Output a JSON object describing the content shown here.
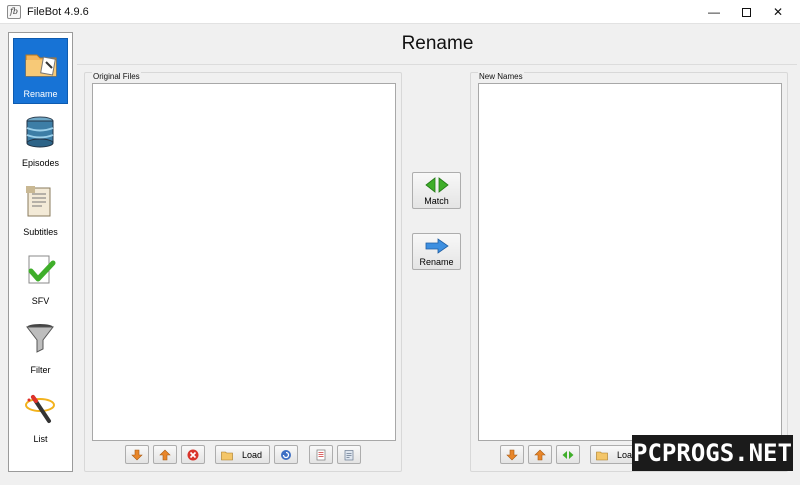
{
  "window": {
    "title": "FileBot 4.9.6",
    "app_icon_text": "fb",
    "min": "—",
    "close": "✕"
  },
  "sidebar": {
    "items": [
      {
        "label": "Rename",
        "icon": "folder-rename-icon",
        "active": true
      },
      {
        "label": "Episodes",
        "icon": "database-icon"
      },
      {
        "label": "Subtitles",
        "icon": "document-icon"
      },
      {
        "label": "SFV",
        "icon": "checkmark-document-icon"
      },
      {
        "label": "Filter",
        "icon": "funnel-icon"
      },
      {
        "label": "List",
        "icon": "magic-wand-icon"
      }
    ]
  },
  "header": {
    "title": "Rename"
  },
  "original_files": {
    "label": "Original Files",
    "toolbar": {
      "load_label": "Load"
    }
  },
  "new_names": {
    "label": "New Names",
    "toolbar": {
      "load_label": "Load"
    }
  },
  "actions": {
    "match_label": "Match",
    "rename_label": "Rename"
  },
  "watermark": {
    "text": "PCPROGS.NET"
  },
  "colors": {
    "accent": "#1773d6",
    "green_arrow": "#3fae2a",
    "blue_arrow": "#3d8fe0",
    "orange_arrow": "#e8862a",
    "red_x": "#d9342b"
  }
}
